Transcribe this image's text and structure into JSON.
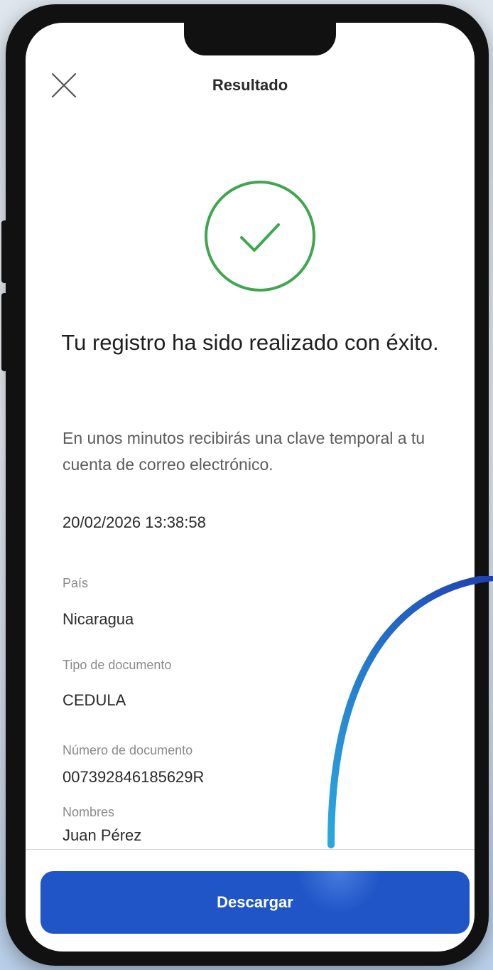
{
  "header": {
    "close_icon": "close-icon",
    "title": "Resultado"
  },
  "status": {
    "icon": "check-circle-icon",
    "color": "#3fa64f",
    "headline": "Tu registro ha sido realizado con éxito.",
    "message": "En unos minutos recibirás una clave temporal a tu cuenta de correo electrónico."
  },
  "timestamp": "20/02/2026 13:38:58",
  "fields": [
    {
      "label": "País",
      "value": "Nicaragua"
    },
    {
      "label": "Tipo de documento",
      "value": "CEDULA"
    },
    {
      "label": "Número de documento",
      "value": "007392846185629R"
    },
    {
      "label": "Nombres",
      "value": "Juan Pérez"
    }
  ],
  "actions": {
    "download_label": "Descargar",
    "accent": "#1f55c6"
  }
}
